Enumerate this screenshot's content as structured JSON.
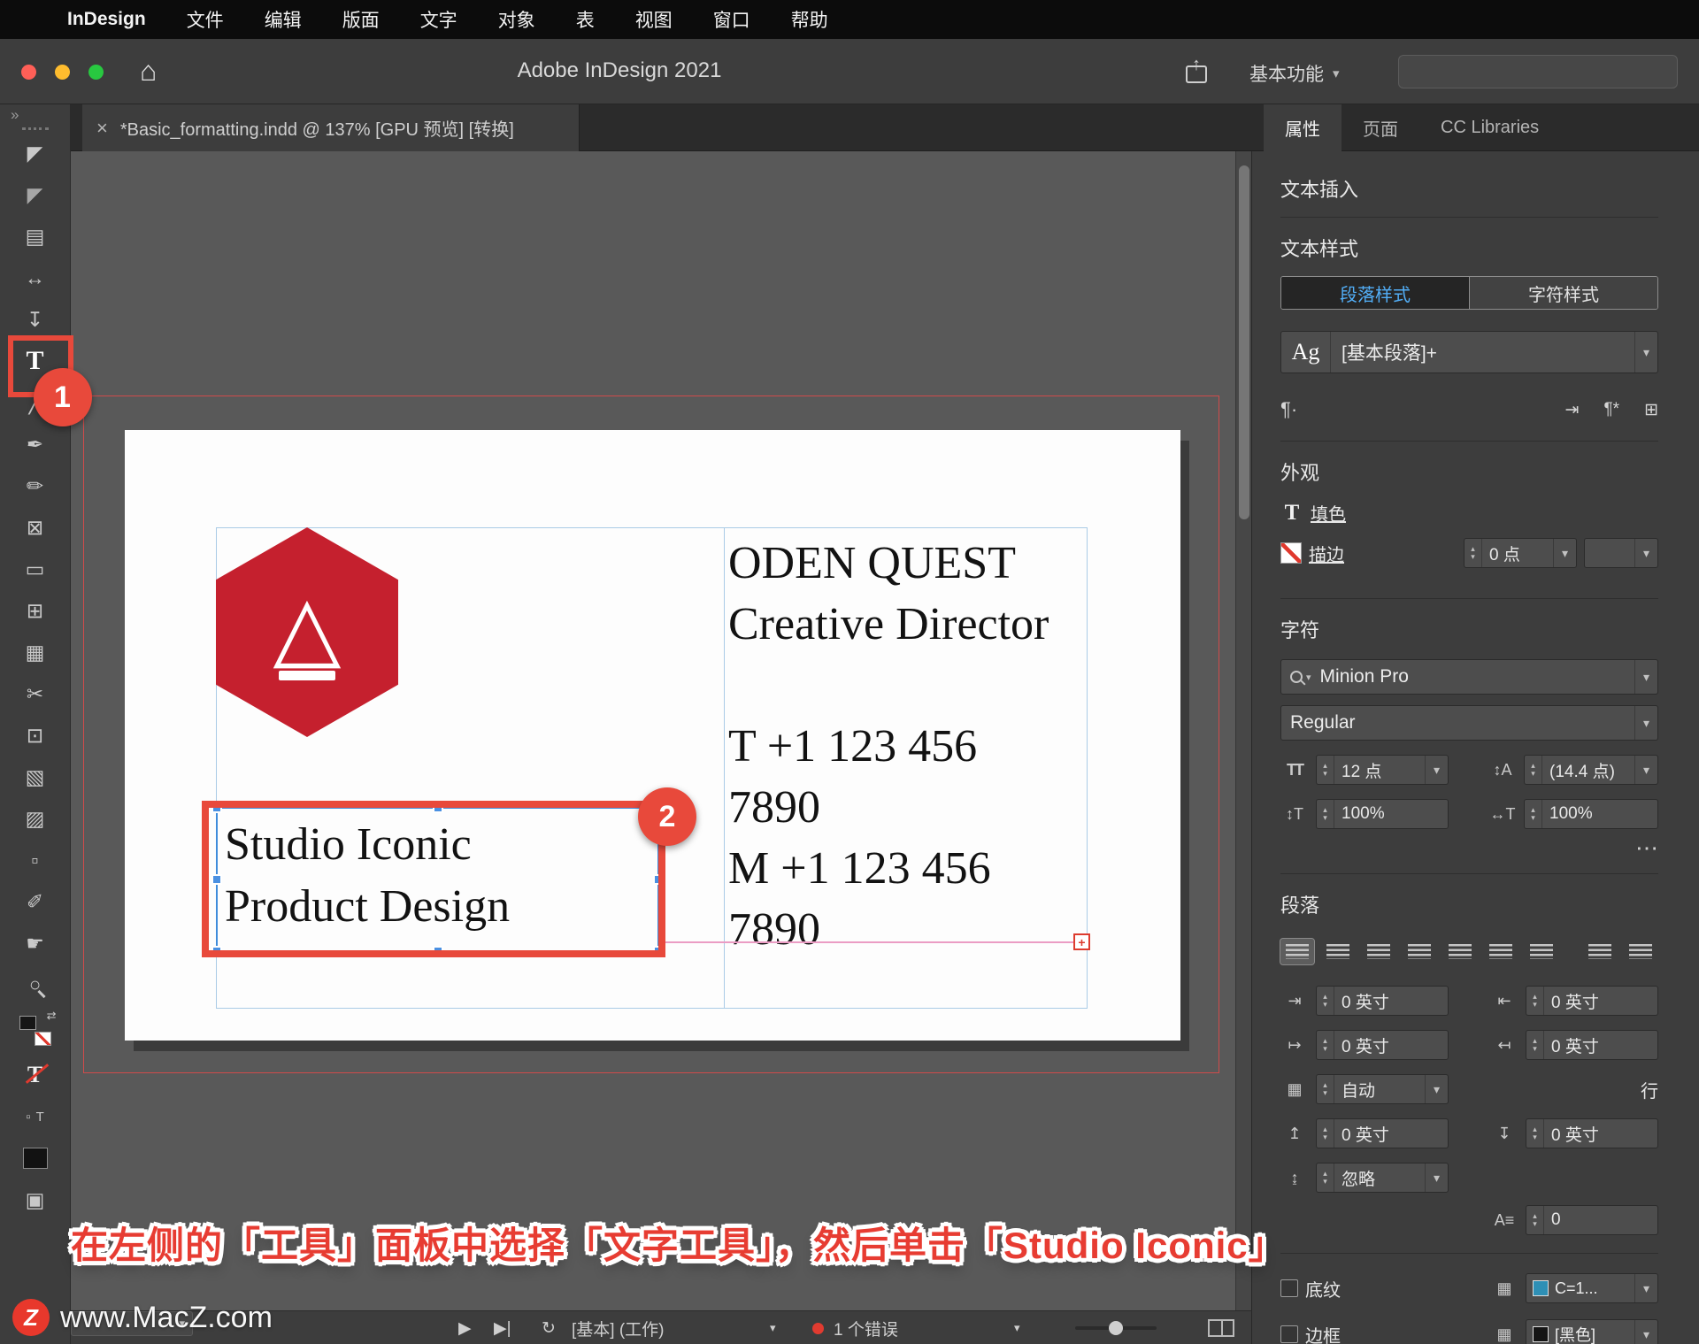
{
  "menubar": {
    "apple_logo": "",
    "app_name": "InDesign",
    "items": [
      "文件",
      "编辑",
      "版面",
      "文字",
      "对象",
      "表",
      "视图",
      "窗口",
      "帮助"
    ]
  },
  "titlebar": {
    "title": "Adobe InDesign 2021",
    "workspace": "基本功能"
  },
  "tabbar": {
    "close_icon": "×",
    "document_tab": "*Basic_formatting.indd @ 137% [GPU 预览] [转换]"
  },
  "panel_tabs": {
    "properties": "属性",
    "pages": "页面",
    "cc_libraries": "CC Libraries"
  },
  "toolbar": {
    "overflow": "»"
  },
  "tools": [
    {
      "name": "selection-tool",
      "glyph": "◤"
    },
    {
      "name": "direct-selection-tool",
      "glyph": "◤"
    },
    {
      "name": "page-tool",
      "glyph": "▤"
    },
    {
      "name": "gap-tool",
      "glyph": "↔"
    },
    {
      "name": "content-collector-tool",
      "glyph": "↧"
    },
    {
      "name": "type-tool",
      "glyph": "T"
    },
    {
      "name": "line-tool",
      "glyph": "╱"
    },
    {
      "name": "pen-tool",
      "glyph": "✒"
    },
    {
      "name": "pencil-tool",
      "glyph": "✏"
    },
    {
      "name": "rectangle-frame-tool",
      "glyph": "⊠"
    },
    {
      "name": "rectangle-tool",
      "glyph": "▭"
    },
    {
      "name": "table-tool",
      "glyph": "⊞"
    },
    {
      "name": "grid-tool",
      "glyph": "▦"
    },
    {
      "name": "scissors-tool",
      "glyph": "✂"
    },
    {
      "name": "free-transform-tool",
      "glyph": "⊡"
    },
    {
      "name": "gradient-swatch-tool",
      "glyph": "▧"
    },
    {
      "name": "gradient-feather-tool",
      "glyph": "▨"
    },
    {
      "name": "note-tool",
      "glyph": "▫"
    },
    {
      "name": "eyedropper-tool",
      "glyph": "✐"
    },
    {
      "name": "hand-tool",
      "glyph": "☛"
    },
    {
      "name": "zoom-tool",
      "glyph": "○"
    }
  ],
  "color_tools": {
    "swap": "⇄",
    "text_none": "T",
    "mini_box": "▫",
    "mini_t": "T",
    "screen_mode": "▣"
  },
  "badges": {
    "step1": "1",
    "step2": "2"
  },
  "caption": "在左侧的「工具」面板中选择「文字工具」，然后单击「Studio Iconic」",
  "document": {
    "right_frame_lines": [
      "ODEN QUEST",
      "Creative Director",
      "",
      "T +1 123 456",
      "7890",
      "M +1 123 456",
      "7890"
    ],
    "selected_frame_lines": [
      "Studio Iconic",
      "Product Design"
    ],
    "overset_plus": "+"
  },
  "properties": {
    "text_insert": "文本插入",
    "text_styles": "文本样式",
    "paragraph_styles": "段落样式",
    "character_styles": "字符样式",
    "style_sample": "Ag",
    "style_name": "[基本段落]+",
    "appearance": {
      "title": "外观",
      "fill": "填色",
      "stroke": "描边",
      "stroke_weight": "0 点"
    },
    "character": {
      "title": "字符",
      "font": "Minion Pro",
      "style": "Regular",
      "size": "12 点",
      "leading": "(14.4 点)",
      "v_scale": "100%",
      "h_scale": "100%"
    },
    "paragraph": {
      "title": "段落",
      "indent_left": "0 英寸",
      "indent_right": "0 英寸",
      "indent_first": "0 英寸",
      "indent_last": "0 英寸",
      "grid": "自动",
      "grid_unit": "行",
      "space_before": "0 英寸",
      "space_after": "0 英寸",
      "space_between": "忽略",
      "baseline_shift": "0"
    },
    "shading": {
      "label": "底纹",
      "value": "C=1..."
    },
    "border": {
      "label": "边框",
      "value": "[黑色]"
    }
  },
  "statusbar": {
    "preflight_profile": "[基本] (工作)",
    "errors": "1 个错误"
  },
  "watermark": {
    "logo": "Z",
    "text": "www.MacZ.com"
  },
  "icons": {
    "home": "⌂",
    "share_arrow": "↑",
    "para_mark": "¶·",
    "redefine_style": "⇥",
    "style_override": "¶*",
    "new_style": "⊞",
    "ellipsis": "⋯",
    "font_size": "TT",
    "leading": "↕A",
    "v_scale": "↕T",
    "h_scale": "↔T",
    "indent_left": "⇥",
    "indent_right": "⇤",
    "indent_first": "↦",
    "indent_last": "↤",
    "grid": "▦",
    "space_before": "↥",
    "space_after": "↧",
    "space_between": "↨",
    "baseline": "A≡",
    "play": "▶",
    "play_end": "▶|",
    "refresh": "↻"
  }
}
